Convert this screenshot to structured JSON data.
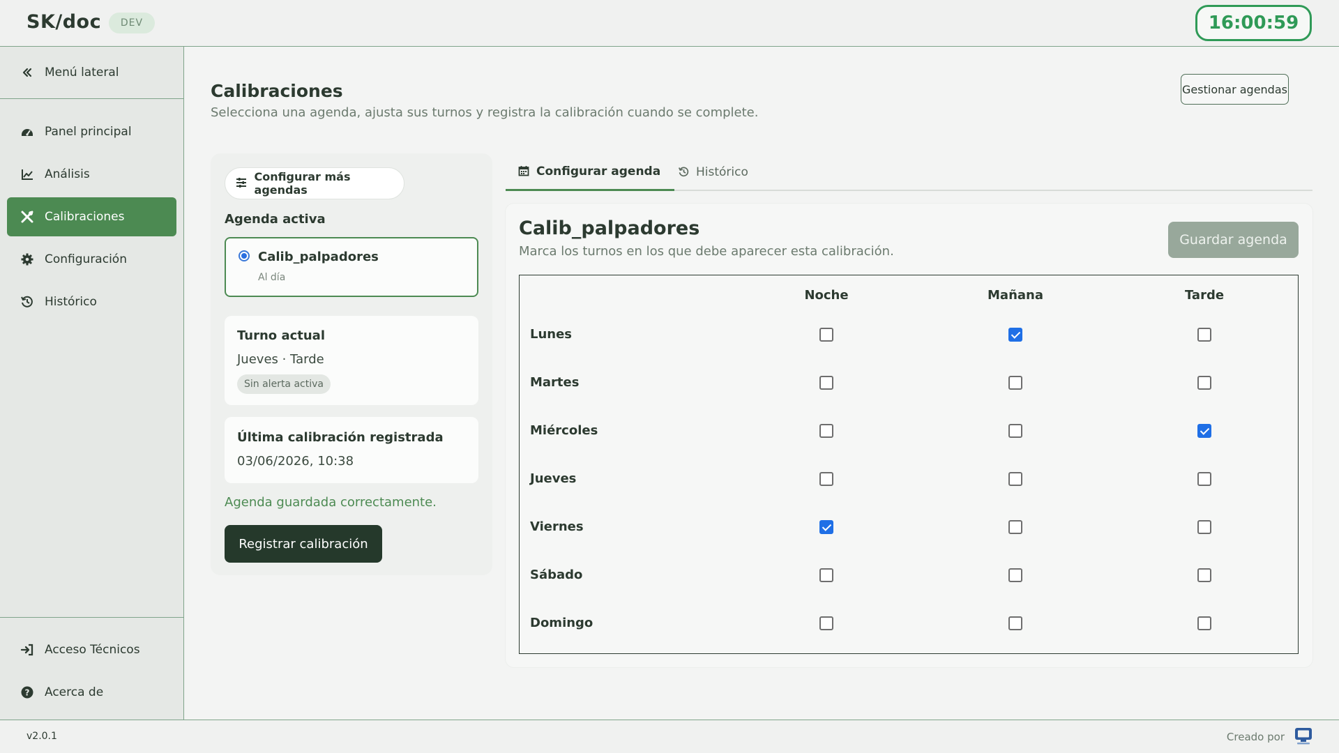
{
  "header": {
    "brand": "SK/doc",
    "env": "DEV",
    "clock": "16:00:59"
  },
  "sidebar": {
    "toggle_label": "Menú lateral",
    "items": [
      {
        "label": "Panel principal",
        "icon": "dashboard-icon"
      },
      {
        "label": "Análisis",
        "icon": "chart-line-icon"
      },
      {
        "label": "Calibraciones",
        "icon": "tools-icon",
        "active": true
      },
      {
        "label": "Configuración",
        "icon": "gear-icon"
      },
      {
        "label": "Histórico",
        "icon": "history-icon"
      }
    ],
    "bottom_items": [
      {
        "label": "Acceso Técnicos",
        "icon": "sign-in-icon"
      },
      {
        "label": "Acerca de",
        "icon": "question-icon"
      }
    ]
  },
  "page": {
    "title": "Calibraciones",
    "subtitle": "Selecciona una agenda, ajusta sus turnos y registra la calibración cuando se complete.",
    "manage_button": "Gestionar agendas"
  },
  "left_panel": {
    "configure_more": "Configurar más agendas",
    "active_label": "Agenda activa",
    "agenda_name": "Calib_palpadores",
    "agenda_status": "Al día",
    "current_shift_title": "Turno actual",
    "current_shift_value": "Jueves · Tarde",
    "alert_tag": "Sin alerta activa",
    "last_cal_title": "Última calibración registrada",
    "last_cal_value": "03/06/2026, 10:38",
    "saved_message": "Agenda guardada correctamente.",
    "register_button": "Registrar calibración"
  },
  "tabs": [
    {
      "label": "Configurar agenda",
      "icon": "calendar-icon",
      "active": true
    },
    {
      "label": "Histórico",
      "icon": "history-icon",
      "active": false
    }
  ],
  "schedule": {
    "title": "Calib_palpadores",
    "subtitle": "Marca los turnos en los que debe aparecer esta calibración.",
    "save_button": "Guardar agenda",
    "columns": [
      "Noche",
      "Mañana",
      "Tarde"
    ],
    "rows": [
      {
        "day": "Lunes",
        "checks": [
          false,
          true,
          false
        ]
      },
      {
        "day": "Martes",
        "checks": [
          false,
          false,
          false
        ]
      },
      {
        "day": "Miércoles",
        "checks": [
          false,
          false,
          true
        ]
      },
      {
        "day": "Jueves",
        "checks": [
          false,
          false,
          false
        ]
      },
      {
        "day": "Viernes",
        "checks": [
          true,
          false,
          false
        ]
      },
      {
        "day": "Sábado",
        "checks": [
          false,
          false,
          false
        ]
      },
      {
        "day": "Domingo",
        "checks": [
          false,
          false,
          false
        ]
      }
    ]
  },
  "footer": {
    "version": "v2.0.1",
    "created_by": "Creado por",
    "logo_icon": "monitor-logo-icon"
  },
  "colors": {
    "accent": "#4c8a52",
    "clock": "#2f9a57",
    "dark_button": "#25392b",
    "checkbox": "#1f6fe6"
  }
}
